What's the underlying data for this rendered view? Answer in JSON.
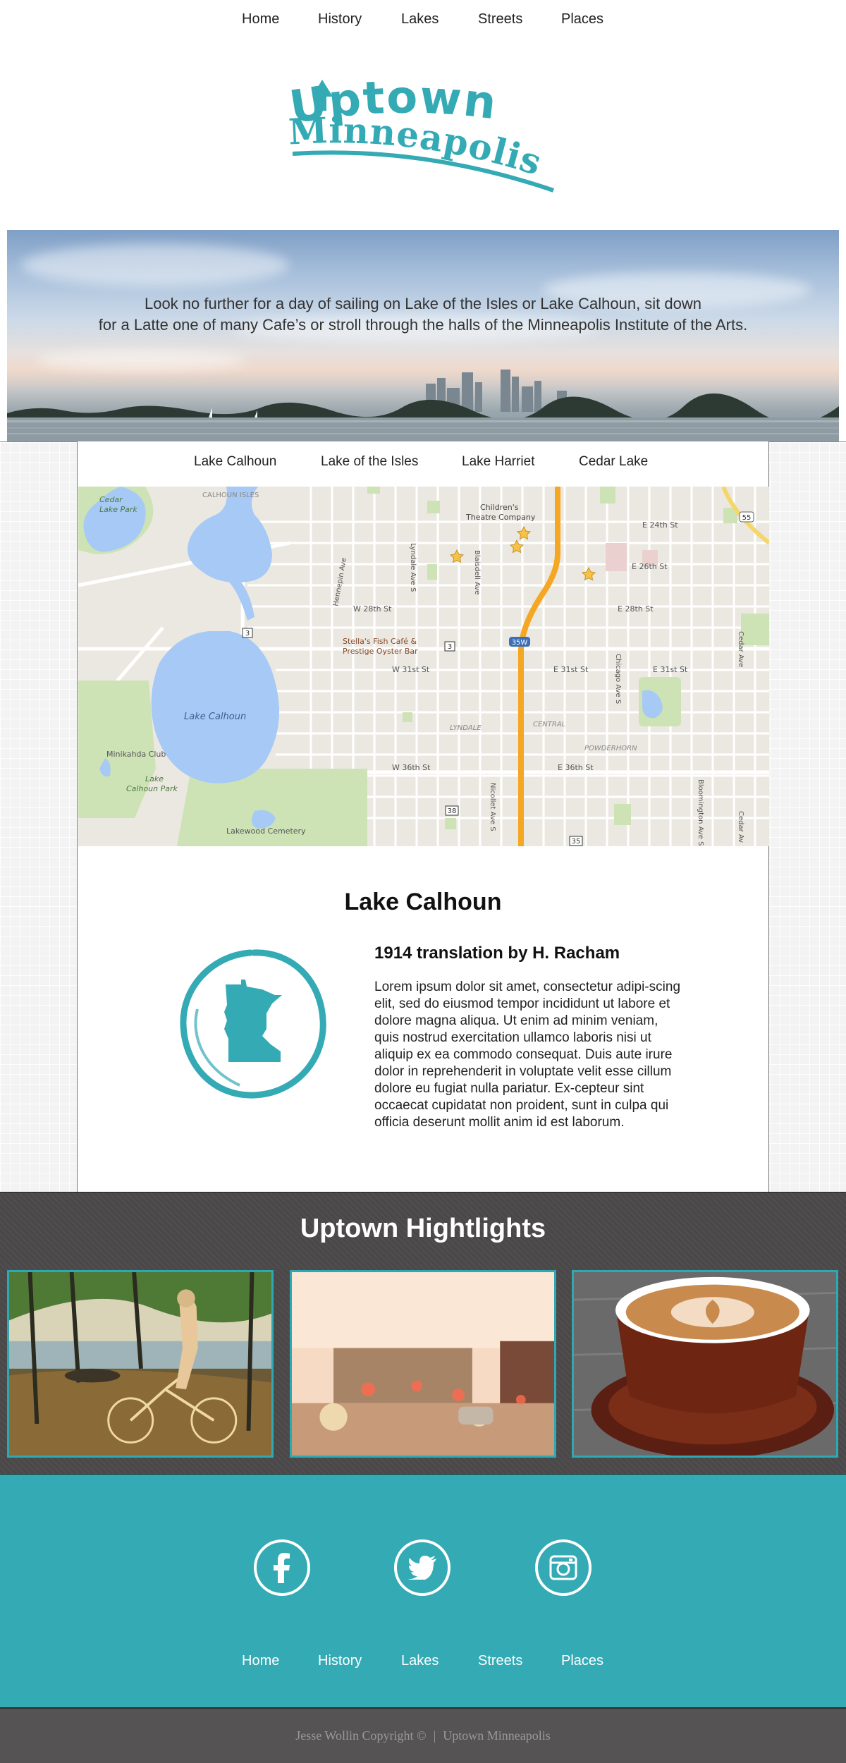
{
  "nav": {
    "items": [
      {
        "label": "Home"
      },
      {
        "label": "History"
      },
      {
        "label": "Lakes"
      },
      {
        "label": "Streets"
      },
      {
        "label": "Places"
      }
    ]
  },
  "logo": {
    "line1": "Uptown",
    "line2": "Minneapolis"
  },
  "hero": {
    "line1": "Look no further for a day of sailing on Lake of the Isles or Lake Calhoun, sit down",
    "line2": "for a Latte one of many Cafe’s or stroll through the halls of the Minneapolis Institute of the Arts."
  },
  "lake_tabs": [
    {
      "label": "Lake Calhoun"
    },
    {
      "label": "Lake of the Isles"
    },
    {
      "label": "Lake Harriet"
    },
    {
      "label": "Cedar Lake"
    }
  ],
  "map": {
    "labels": {
      "cedar_lake_park": [
        "Cedar",
        "Lake Park"
      ],
      "calhoun_isles": "CALHOUN ISLES",
      "childrens_theatre": [
        "Children's",
        "Theatre Company"
      ],
      "e24": "E 24th St",
      "e26": "E 26th St",
      "w28": "W 28th St",
      "e28": "E 28th St",
      "stellas": [
        "Stella's Fish Café &",
        "Prestige Oyster Bar"
      ],
      "w31": "W 31st St",
      "e31a": "E 31st St",
      "e31b": "E 31st St",
      "lake_calhoun": "Lake Calhoun",
      "lyndale": "LYNDALE",
      "central": "CENTRAL",
      "powderhorn": "POWDERHORN",
      "minikahda": "Minikahda Club",
      "calhoun_park": [
        "Lake",
        "Calhoun Park"
      ],
      "w36": "W 36th St",
      "e36": "E 36th St",
      "lakewood": "Lakewood Cemetery",
      "hennepin": "Hennepin Ave",
      "lyndale_ave": "Lyndale Ave S",
      "blaisdell": "Blaisdell Ave",
      "nicollet": "Nicollet Ave S",
      "chicago": "Chicago Ave S",
      "cedar_ave": "Cedar Ave",
      "cedar_ave2": "Cedar Av",
      "bloomington": "Bloomington Ave S",
      "r55": "55",
      "r3a": "3",
      "r3b": "3",
      "r35w": "35W",
      "r38": "38",
      "r35": "35"
    }
  },
  "article": {
    "title": "Lake Calhoun",
    "subtitle": "1914 translation by H. Racham",
    "body": "Lorem ipsum dolor sit amet, consectetur adipi-scing elit, sed do eiusmod tempor incididunt ut labore et dolore magna aliqua. Ut enim ad minim veniam, quis nostrud exercitation ullamco laboris nisi ut aliquip ex ea commodo consequat. Duis aute irure dolor in reprehenderit in voluptate velit esse cillum dolore eu fugiat nulla pariatur. Ex-cepteur sint occaecat cupidatat non proident, sunt in culpa qui officia deserunt mollit anim id est laborum."
  },
  "highlights": {
    "title": "Uptown Hightlights"
  },
  "footer": {
    "social": [
      {
        "icon": "facebook-icon"
      },
      {
        "icon": "twitter-icon"
      },
      {
        "icon": "instagram-icon"
      }
    ],
    "links": [
      {
        "label": "Home"
      },
      {
        "label": "History"
      },
      {
        "label": "Lakes"
      },
      {
        "label": "Streets"
      },
      {
        "label": "Places"
      }
    ],
    "copyright_left": "Jesse Wollin Copyright ©",
    "copyright_sep": "|",
    "copyright_right": "Uptown Minneapolis"
  },
  "colors": {
    "accent": "#33aab4",
    "dark_band": "#4a4849",
    "copyright_bar": "#555354"
  }
}
